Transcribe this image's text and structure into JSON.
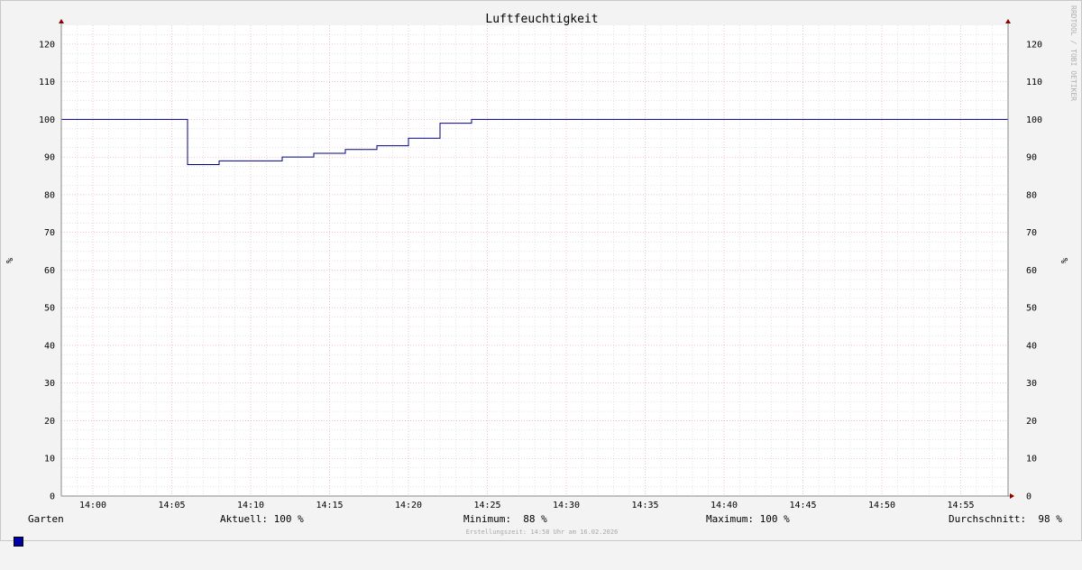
{
  "chart_data": {
    "type": "line",
    "title": "Luftfeuchtigkeit",
    "ylabel": "%",
    "ylabel_right": "%",
    "ylim": [
      0,
      125
    ],
    "y_ticks": [
      0,
      10,
      20,
      30,
      40,
      50,
      60,
      70,
      80,
      90,
      100,
      110,
      120
    ],
    "xlim": [
      "13:58",
      "14:58"
    ],
    "x_ticks": [
      "14:00",
      "14:05",
      "14:10",
      "14:15",
      "14:20",
      "14:25",
      "14:30",
      "14:35",
      "14:40",
      "14:45",
      "14:50",
      "14:55"
    ],
    "grid": true,
    "series": [
      {
        "name": "Garten",
        "color": "#000080",
        "step": true,
        "points": [
          [
            "13:58",
            100
          ],
          [
            "14:06",
            88
          ],
          [
            "14:08",
            89
          ],
          [
            "14:12",
            90
          ],
          [
            "14:14",
            91
          ],
          [
            "14:16",
            92
          ],
          [
            "14:18",
            93
          ],
          [
            "14:20",
            95
          ],
          [
            "14:22",
            99
          ],
          [
            "14:24",
            100
          ],
          [
            "14:58",
            100
          ]
        ]
      }
    ]
  },
  "watermark": "RRDTOOL / TOBI OETIKER",
  "legend": {
    "series_name": "Garten",
    "swatch_color": "#0000a8",
    "current": "Aktuell: 100 %",
    "minimum": "Minimum:  88 %",
    "maximum": "Maximum: 100 %",
    "average": "Durchschnitt:  98 %"
  },
  "footer": "Erstellungszeit: 14:58 Uhr am 16.02.2026",
  "colors": {
    "background": "#f3f3f3",
    "plot_bg": "#ffffff",
    "major_grid": "#e8a0a0",
    "minor_grid": "#c8c8c8",
    "line": "#000080",
    "axis_arrow": "#8b0000"
  }
}
